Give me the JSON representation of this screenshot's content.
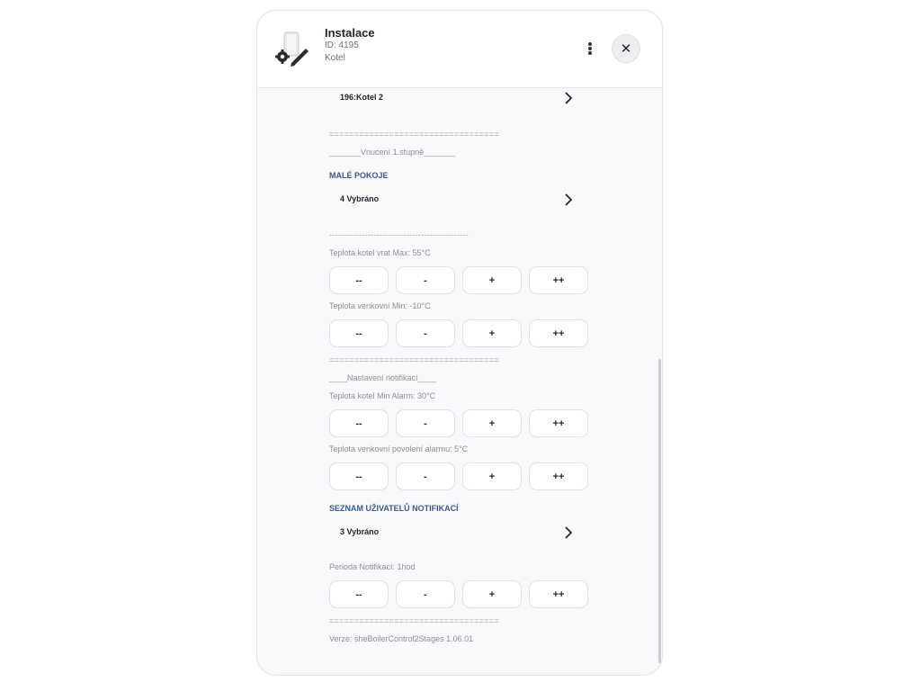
{
  "header": {
    "title": "Instalace",
    "id_line": "ID: 4195",
    "type_line": "Kotel",
    "device_icon": "boiler-settings-icon",
    "menu_icon": "kebab-menu-icon",
    "close_icon": "close-icon",
    "close_glyph": "✕"
  },
  "rows": {
    "kotel_select": "196:Kotel 2",
    "sep1": "==================================",
    "vnuceni": "_______Vnucení 1.stupně_______",
    "male_pokoje_title": "MALÉ POKOJE",
    "male_pokoje_select": "4 Vybráno",
    "dash_sep": "-----------------------------------------------",
    "teplota_kotel_vrat": "Teplota kotel vrat Max: 55°C",
    "teplota_venkovni_min": "Teplota venkovní Min: -10°C",
    "sep2": "==================================",
    "nastaveni": "____Nastavení notifikací____",
    "teplota_kotel_alarm": "Teplota kotel Min Alarm: 30°C",
    "teplota_venkovni_alarm": "Teplota venkovní povolení alarmu: 5°C",
    "seznam_title": "SEZNAM UŽIVATELŮ NOTIFIKACÍ",
    "seznam_select": "3 Vybráno",
    "perioda": "Perioda Notifikací: 1hod",
    "sep3": "==================================",
    "verze": "Verze: sheBoilerControl2Stages 1.06.01"
  },
  "stepper": {
    "dec_big": "--",
    "dec": "-",
    "inc": "+",
    "inc_big": "++"
  },
  "colors": {
    "section_title": "#3b5a8a",
    "panel_bg": "#f8f9fb",
    "header_bg": "#ffffff"
  }
}
